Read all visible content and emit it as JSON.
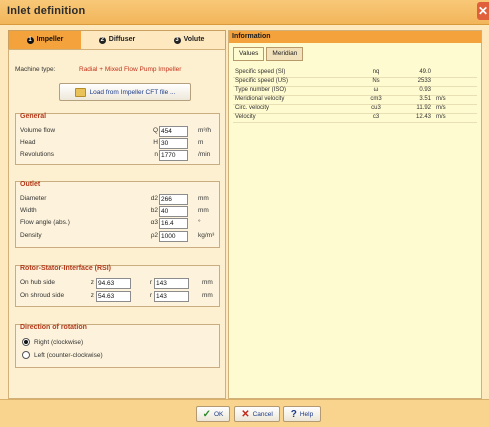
{
  "window": {
    "title": "Inlet definition"
  },
  "tabs": [
    {
      "label": "Impeller",
      "num": "1"
    },
    {
      "label": "Diffuser",
      "num": "2"
    },
    {
      "label": "Volute",
      "num": "3"
    }
  ],
  "machine": {
    "label": "Machine type:",
    "value": "Radial + Mixed Flow Pump Impeller",
    "load_button": "Load from Impeller CFT file ..."
  },
  "general": {
    "title": "General",
    "rows": [
      {
        "label": "Volume flow",
        "sym": "Q",
        "value": "454",
        "unit": "m³/h"
      },
      {
        "label": "Head",
        "sym": "H",
        "value": "30",
        "unit": "m"
      },
      {
        "label": "Revolutions",
        "sym": "n",
        "value": "1770",
        "unit": "/min"
      }
    ]
  },
  "outlet": {
    "title": "Outlet",
    "rows": [
      {
        "label": "Diameter",
        "sym": "d2",
        "value": "266",
        "unit": "mm"
      },
      {
        "label": "Width",
        "sym": "b2",
        "value": "40",
        "unit": "mm"
      },
      {
        "label": "Flow angle (abs.)",
        "sym": "α3",
        "value": "16.4",
        "unit": "°"
      },
      {
        "label": "Density",
        "sym": "ρ2",
        "value": "1000",
        "unit": "kg/m³"
      }
    ]
  },
  "rsi": {
    "title": "Rotor-Stator-Interface (RSI)",
    "rows": [
      {
        "label": "On hub side",
        "zsym": "z",
        "z": "94.63",
        "rsym": "r",
        "r": "143",
        "unit": "mm"
      },
      {
        "label": "On shroud side",
        "zsym": "z",
        "z": "54.63",
        "rsym": "r",
        "r": "143",
        "unit": "mm"
      }
    ]
  },
  "rotation": {
    "title": "Direction of rotation",
    "options": [
      {
        "label": "Right (clockwise)",
        "selected": true
      },
      {
        "label": "Left (counter-clockwise)",
        "selected": false
      }
    ]
  },
  "info": {
    "title": "Information",
    "tabs": [
      "Values",
      "Meridian"
    ],
    "rows": [
      {
        "name": "Specific speed (SI)",
        "sym": "nq",
        "value": "49.0",
        "unit": ""
      },
      {
        "name": "Specific speed (US)",
        "sym": "Ns",
        "value": "2533",
        "unit": ""
      },
      {
        "name": "Type number (ISO)",
        "sym": "ω",
        "value": "0.93",
        "unit": ""
      },
      {
        "name": "Meridional velocity",
        "sym": "cm3",
        "value": "3.51",
        "unit": "m/s"
      },
      {
        "name": "Circ. velocity",
        "sym": "cu3",
        "value": "11.92",
        "unit": "m/s"
      },
      {
        "name": "Velocity",
        "sym": "c3",
        "value": "12.43",
        "unit": "m/s"
      }
    ]
  },
  "buttons": {
    "ok": "OK",
    "cancel": "Cancel",
    "help": "Help"
  }
}
